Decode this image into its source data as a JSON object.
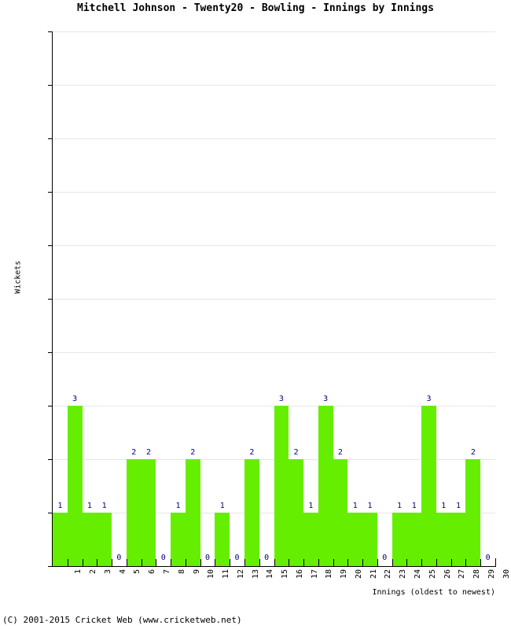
{
  "chart_data": {
    "type": "bar",
    "title": "Mitchell Johnson - Twenty20 - Bowling - Innings by Innings",
    "xlabel": "Innings (oldest to newest)",
    "ylabel": "Wickets",
    "categories": [
      "1",
      "2",
      "3",
      "4",
      "5",
      "6",
      "7",
      "8",
      "9",
      "10",
      "11",
      "12",
      "13",
      "14",
      "15",
      "16",
      "17",
      "18",
      "19",
      "20",
      "21",
      "22",
      "23",
      "24",
      "25",
      "26",
      "27",
      "28",
      "29",
      "30"
    ],
    "values": [
      1,
      3,
      1,
      1,
      0,
      2,
      2,
      0,
      1,
      2,
      0,
      1,
      0,
      2,
      0,
      3,
      2,
      1,
      3,
      2,
      1,
      1,
      0,
      1,
      1,
      3,
      1,
      1,
      2,
      0
    ],
    "data_labels": [
      "1",
      "3",
      "1",
      "1",
      "0",
      "2",
      "2",
      "0",
      "1",
      "2",
      "0",
      "1",
      "0",
      "2",
      "0",
      "3",
      "2",
      "1",
      "3",
      "2",
      "1",
      "1",
      "0",
      "1",
      "1",
      "3",
      "1",
      "1",
      "2",
      "0"
    ],
    "ylim": [
      0,
      10
    ],
    "y_ticks": [
      "0",
      "1",
      "2",
      "3",
      "4",
      "5",
      "6",
      "7",
      "8",
      "9",
      "10"
    ],
    "grid": true,
    "legend": false,
    "bar_color": "#66ee00",
    "label_color": "#000080",
    "grid_color": "#e6e6e6",
    "axis_color": "#000000"
  },
  "footer": {
    "copyright": "(C) 2001-2015 Cricket Web (www.cricketweb.net)"
  }
}
